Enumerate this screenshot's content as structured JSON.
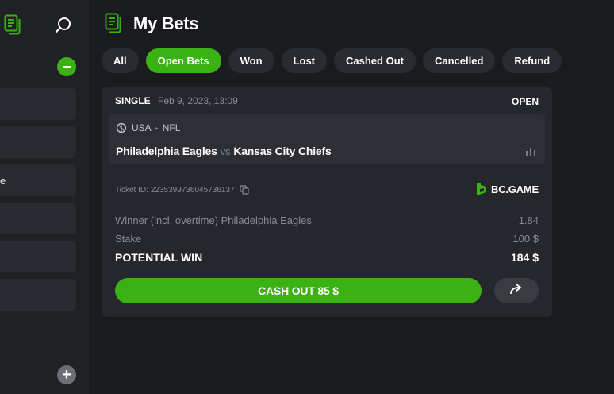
{
  "sidebar": {
    "partial_item_text": "e"
  },
  "header": {
    "title": "My Bets"
  },
  "tabs": [
    {
      "label": "All",
      "active": false
    },
    {
      "label": "Open Bets",
      "active": true
    },
    {
      "label": "Won",
      "active": false
    },
    {
      "label": "Lost",
      "active": false
    },
    {
      "label": "Cashed Out",
      "active": false
    },
    {
      "label": "Cancelled",
      "active": false
    },
    {
      "label": "Refund",
      "active": false
    }
  ],
  "bet": {
    "type": "SINGLE",
    "date": "Feb 9, 2023, 13:09",
    "status": "OPEN",
    "country": "USA",
    "league": "NFL",
    "home_team": "Philadelphia Eagles",
    "vs": "vs",
    "away_team": "Kansas City Chiefs",
    "ticket_label": "Ticket ID:",
    "ticket_id": "2235399736045736137",
    "brand": "BC.GAME",
    "selection_label": "Winner (incl. overtime) Philadelphia Eagles",
    "odds": "1.84",
    "stake_label": "Stake",
    "stake_value": "100 $",
    "potential_label": "POTENTIAL WIN",
    "potential_value": "184 $",
    "cashout_label": "CASH OUT 85 $"
  },
  "colors": {
    "accent": "#3bb214",
    "background": "#1a1b1f",
    "card": "#26272c"
  },
  "icons": {
    "bets": "bets-document-icon",
    "search": "search-icon",
    "collapse": "minus-icon",
    "add": "plus-icon",
    "league": "football-icon",
    "stats": "bar-chart-icon",
    "copy": "copy-icon",
    "share": "share-arrow-icon"
  }
}
